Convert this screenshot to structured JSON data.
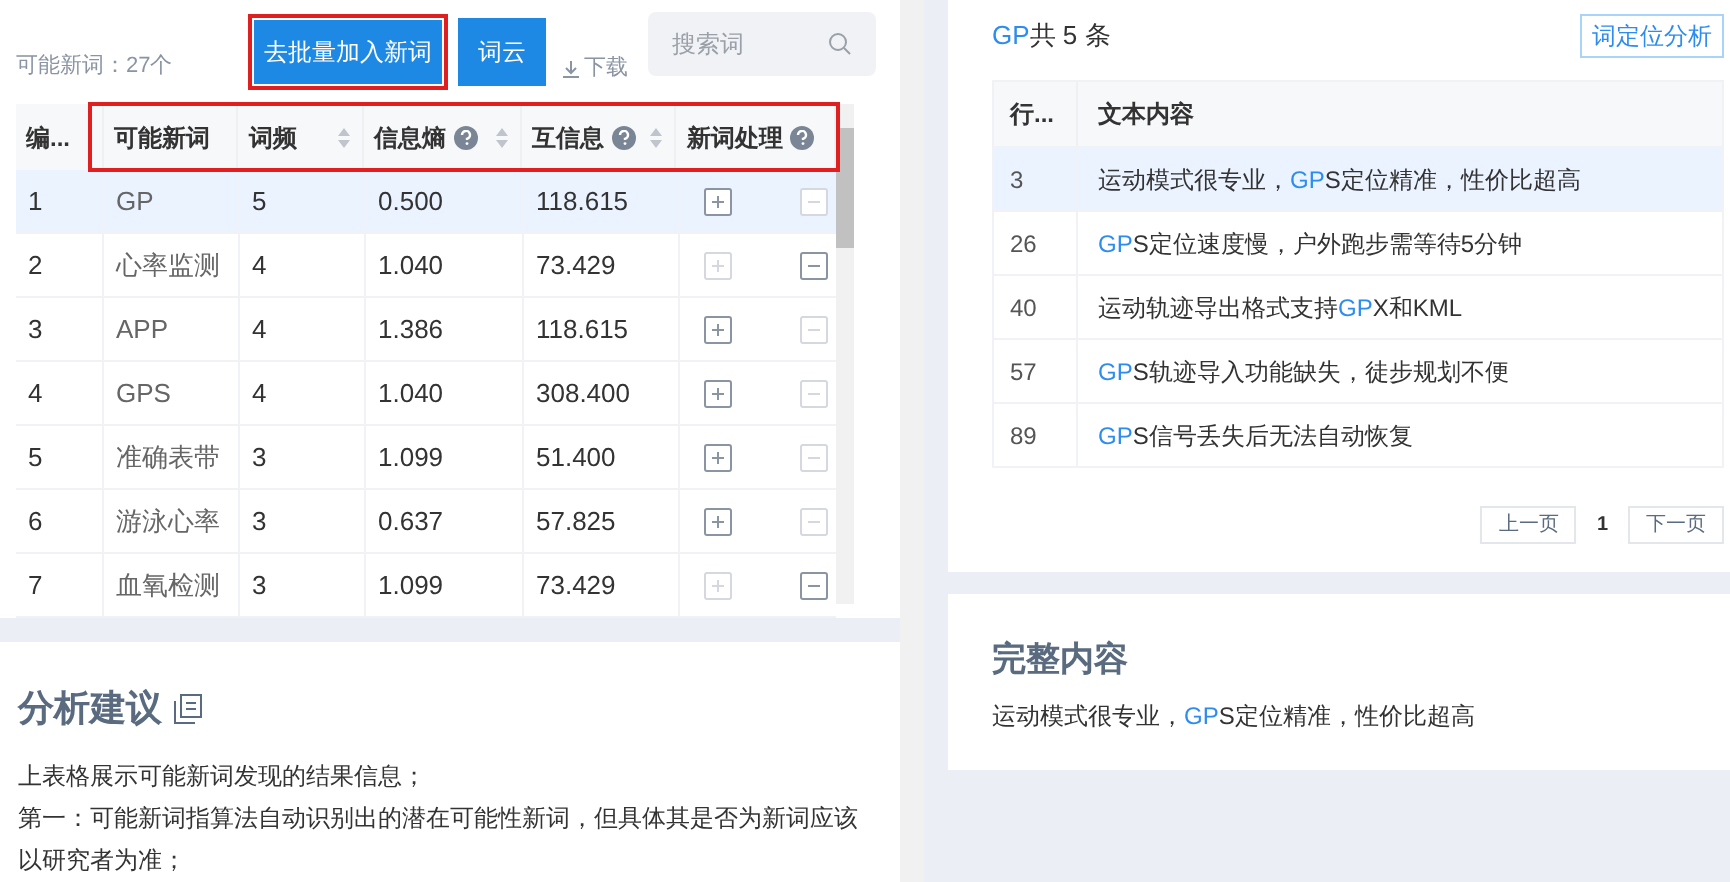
{
  "left": {
    "count_label": "可能新词：27个",
    "batch_button": {
      "label": "去批量加入新词",
      "outlined": true
    },
    "cloud_button": "词云",
    "download_link": "下载",
    "search": {
      "placeholder": "搜索词"
    },
    "table": {
      "header_outlined": true,
      "columns": [
        {
          "label": "编...",
          "sortable": false,
          "help": false
        },
        {
          "label": "可能新词",
          "sortable": false,
          "help": false
        },
        {
          "label": "词频",
          "sortable": true,
          "help": false
        },
        {
          "label": "信息熵",
          "sortable": true,
          "help": true
        },
        {
          "label": "互信息",
          "sortable": true,
          "help": true
        },
        {
          "label": "新词处理",
          "sortable": false,
          "help": true
        }
      ],
      "rows": [
        {
          "cells": [
            "1",
            "GP",
            "5",
            "0.500",
            "118.615"
          ],
          "selected": true,
          "add_active": true,
          "remove_active": false
        },
        {
          "cells": [
            "2",
            "心率监测",
            "4",
            "1.040",
            "73.429"
          ],
          "selected": false,
          "add_active": false,
          "remove_active": true
        },
        {
          "cells": [
            "3",
            "APP",
            "4",
            "1.386",
            "118.615"
          ],
          "selected": false,
          "add_active": true,
          "remove_active": false
        },
        {
          "cells": [
            "4",
            "GPS",
            "4",
            "1.040",
            "308.400"
          ],
          "selected": false,
          "add_active": true,
          "remove_active": false
        },
        {
          "cells": [
            "5",
            "准确表带",
            "3",
            "1.099",
            "51.400"
          ],
          "selected": false,
          "add_active": true,
          "remove_active": false
        },
        {
          "cells": [
            "6",
            "游泳心率",
            "3",
            "0.637",
            "57.825"
          ],
          "selected": false,
          "add_active": true,
          "remove_active": false
        },
        {
          "cells": [
            "7",
            "血氧检测",
            "3",
            "1.099",
            "73.429"
          ],
          "selected": false,
          "add_active": false,
          "remove_active": true
        }
      ]
    },
    "advice": {
      "title": "分析建议",
      "lines": [
        "上表格展示可能新词发现的结果信息；",
        "第一：可能新词指算法自动识别出的潜在可能性新词，但具体其是否为新词应该以研究者为准；"
      ]
    }
  },
  "right": {
    "summary": {
      "word": "GP",
      "rest": "共 5 条"
    },
    "locate_button": "词定位分析",
    "table": {
      "columns": [
        "行...",
        "文本内容"
      ],
      "rows": [
        {
          "line": "3",
          "selected": true,
          "parts": [
            {
              "text": "运动模式很专业，",
              "hit": false
            },
            {
              "text": "GP",
              "hit": true
            },
            {
              "text": "S定位精准，性价比超高",
              "hit": false
            }
          ]
        },
        {
          "line": "26",
          "selected": false,
          "parts": [
            {
              "text": "GP",
              "hit": true
            },
            {
              "text": "S定位速度慢，户外跑步需等待5分钟",
              "hit": false
            }
          ]
        },
        {
          "line": "40",
          "selected": false,
          "parts": [
            {
              "text": "运动轨迹导出格式支持",
              "hit": false
            },
            {
              "text": "GP",
              "hit": true
            },
            {
              "text": "X和KML",
              "hit": false
            }
          ]
        },
        {
          "line": "57",
          "selected": false,
          "parts": [
            {
              "text": "GP",
              "hit": true
            },
            {
              "text": "S轨迹导入功能缺失，徒步规划不便",
              "hit": false
            }
          ]
        },
        {
          "line": "89",
          "selected": false,
          "parts": [
            {
              "text": "GP",
              "hit": true
            },
            {
              "text": "S信号丢失后无法自动恢复",
              "hit": false
            }
          ]
        }
      ]
    },
    "pagination": {
      "prev": "上一页",
      "page": "1",
      "next": "下一页"
    },
    "full": {
      "title": "完整内容",
      "parts": [
        {
          "text": "运动模式很专业，",
          "hit": false
        },
        {
          "text": "GP",
          "hit": true
        },
        {
          "text": "S定位精准，性价比超高",
          "hit": false
        }
      ]
    }
  }
}
